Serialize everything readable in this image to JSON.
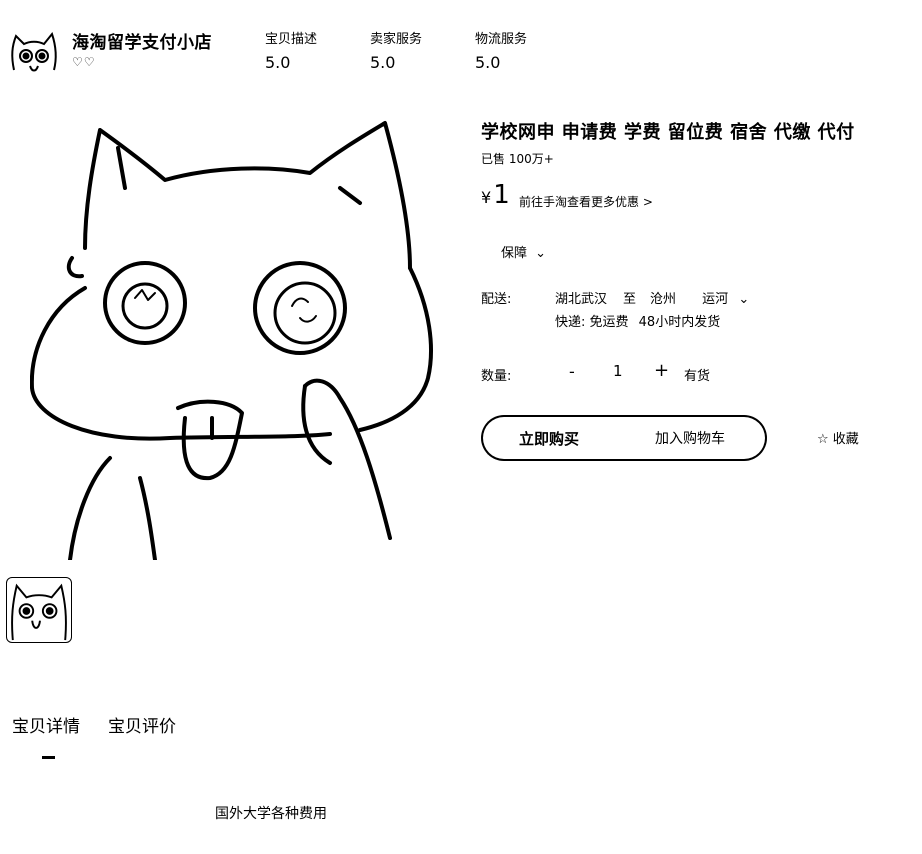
{
  "shop": {
    "name": "海淘留学支付小店",
    "rating_icons": "♡♡",
    "scores": [
      {
        "label": "宝贝描述",
        "value": "5.0"
      },
      {
        "label": "卖家服务",
        "value": "5.0"
      },
      {
        "label": "物流服务",
        "value": "5.0"
      }
    ]
  },
  "product": {
    "title": "学校网申 申请费 学费 留位费 宿舍 代缴 代付",
    "sold": "已售 100万+",
    "price_symbol": "¥",
    "price": "1",
    "promo_link": "前往手淘查看更多优惠 >",
    "guarantee": "保障",
    "shipping": {
      "label": "配送:",
      "from": "湖北武汉",
      "to_word": "至",
      "to_city": "沧州",
      "district": "运河",
      "method": "快递: 免运费",
      "dispatch": "48小时内发货"
    },
    "quantity": {
      "label": "数量:",
      "minus": "-",
      "value": "1",
      "plus": "+",
      "stock": "有货"
    },
    "buttons": {
      "buy": "立即购买",
      "cart": "加入购物车",
      "favorite": "☆ 收藏"
    }
  },
  "tabs": [
    {
      "label": "宝贝详情"
    },
    {
      "label": "宝贝评价"
    }
  ],
  "detail_text": "国外大学各种费用"
}
